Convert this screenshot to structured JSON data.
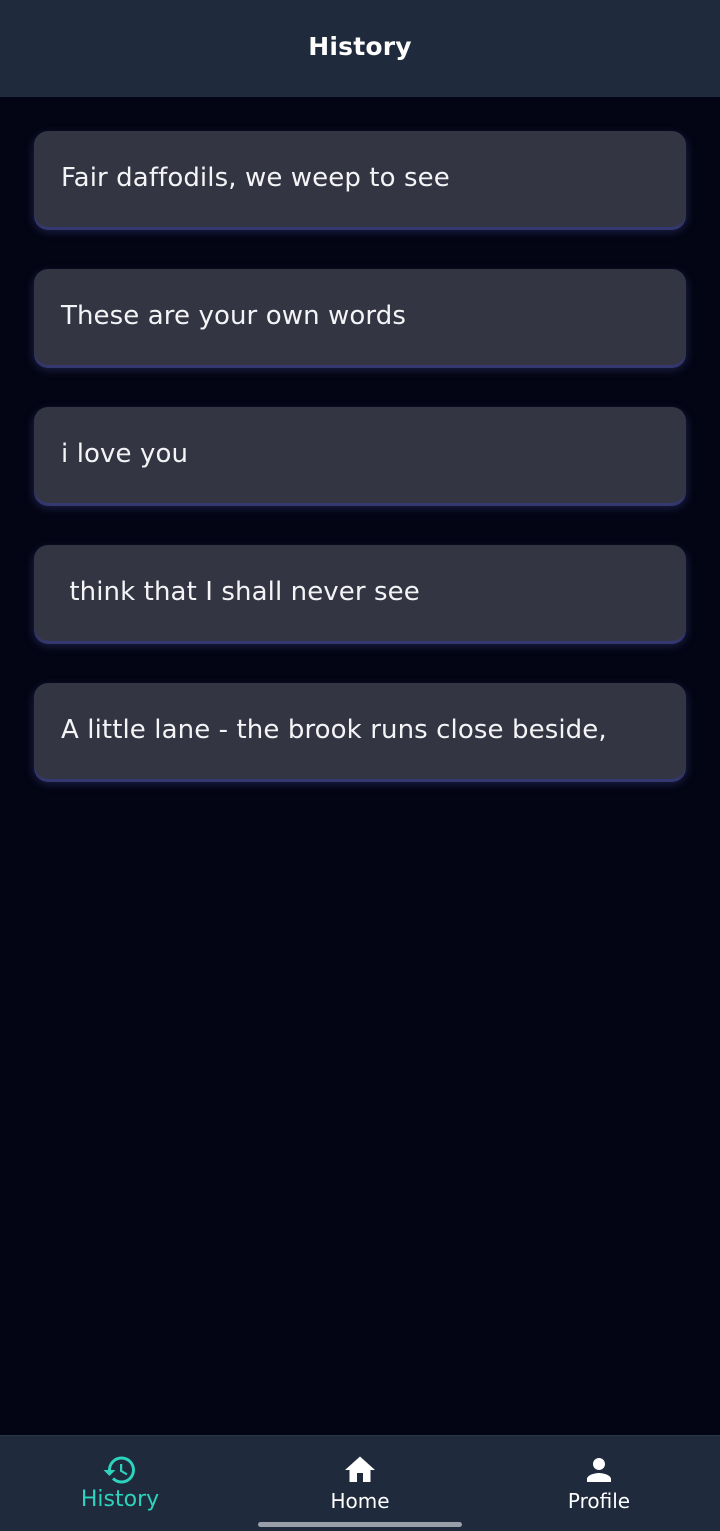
{
  "header": {
    "title": "History"
  },
  "history": {
    "items": [
      {
        "text": "Fair daffodils, we weep to see"
      },
      {
        "text": "These are your own words"
      },
      {
        "text": "i love you"
      },
      {
        "text": " think that I shall never see"
      },
      {
        "text": "A little lane - the brook runs close beside,"
      }
    ]
  },
  "bottom_nav": {
    "items": [
      {
        "label": "History",
        "icon": "history-icon",
        "active": true
      },
      {
        "label": "Home",
        "icon": "home-icon",
        "active": false
      },
      {
        "label": "Profile",
        "icon": "person-icon",
        "active": false
      }
    ]
  },
  "colors": {
    "background": "#030514",
    "bar": "#1f2a3c",
    "card": "#343543",
    "accent": "#2ed3bd",
    "text": "#ffffff"
  }
}
